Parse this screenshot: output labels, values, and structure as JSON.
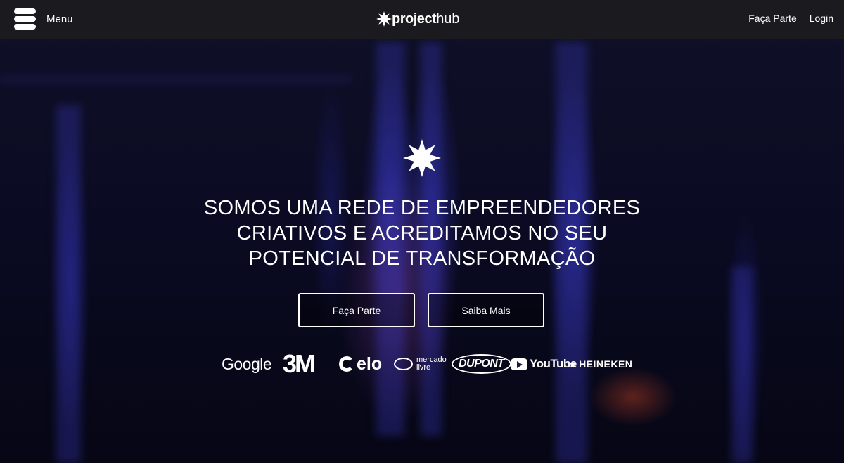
{
  "nav": {
    "menu_label": "Menu",
    "logo_bold": "project",
    "logo_light": "hub",
    "links": [
      "Faça Parte",
      "Login"
    ]
  },
  "hero": {
    "headline_lines": [
      "SOMOS UMA REDE DE EMPREENDEDORES",
      "CRIATIVOS E ACREDITAMOS NO SEU",
      "POTENCIAL DE TRANSFORMAÇÃO"
    ],
    "primary_button": "Faça Parte",
    "secondary_button": "Saiba Mais"
  },
  "partners": {
    "google": "Google",
    "threem": "3M",
    "elo": "elo",
    "mercado_livre_1": "mercado",
    "mercado_livre_2": "livre",
    "dupont": "DUPONT",
    "youtube": "YouTube",
    "heineken_star": "★",
    "heineken": "HEINEKEN"
  },
  "icons": {
    "menu": "hamburger-icon",
    "logo_star": "star-burst-icon",
    "hero_star": "star-burst-icon"
  },
  "colors": {
    "topbar": "#1c1c1e",
    "text": "#ffffff",
    "accent_blue": "#4646e6"
  }
}
